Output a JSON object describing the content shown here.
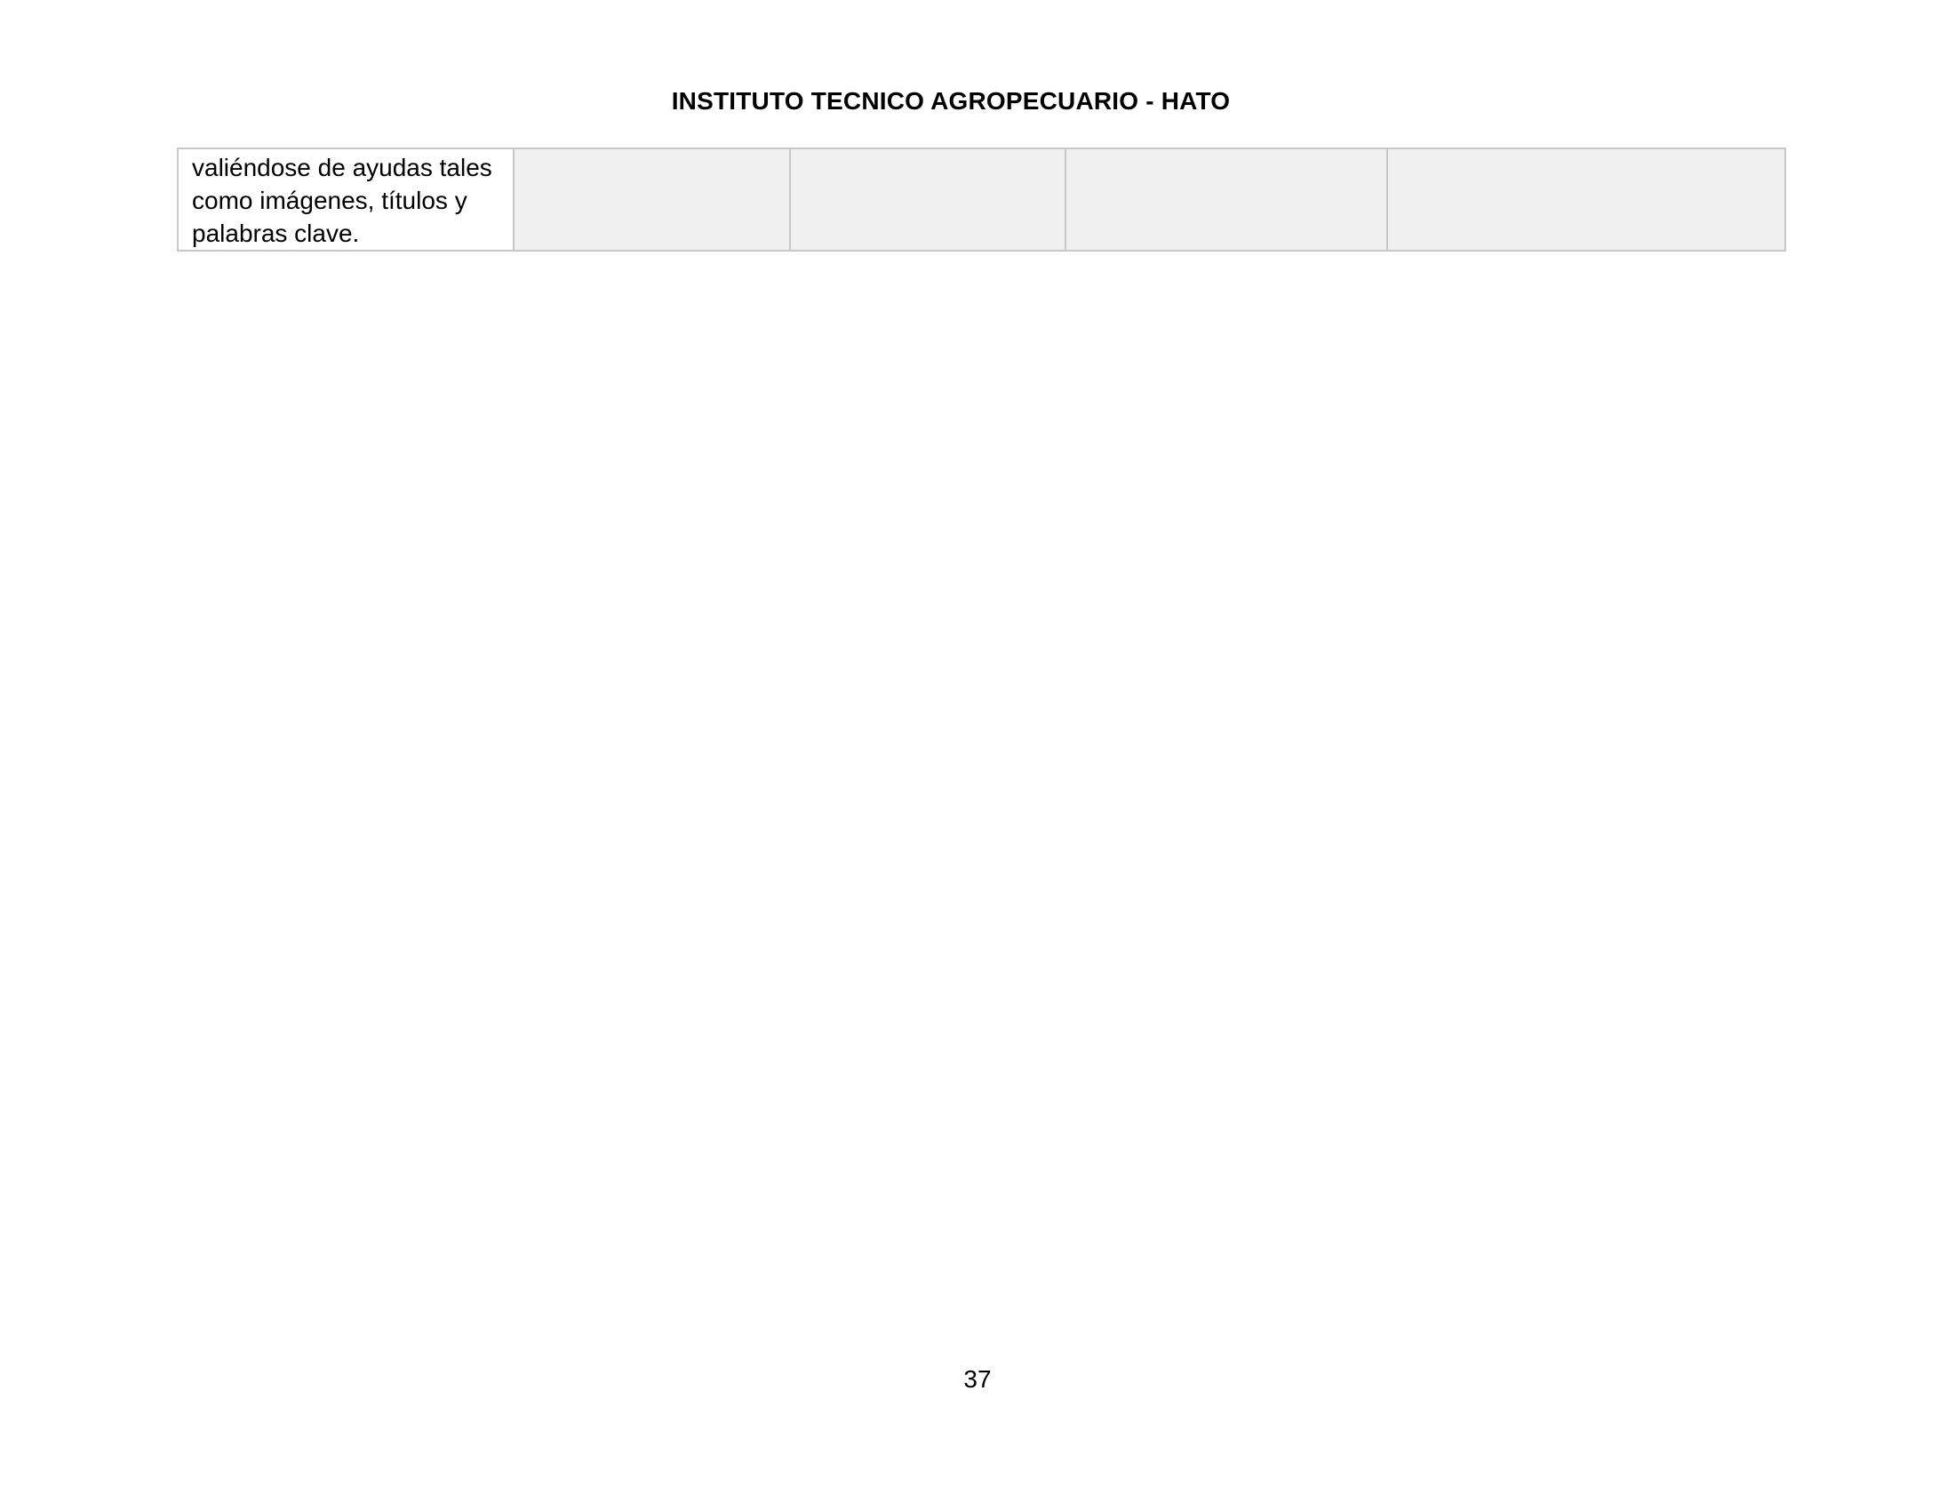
{
  "header": {
    "title": "INSTITUTO TECNICO AGROPECUARIO - HATO"
  },
  "table": {
    "rows": [
      {
        "cells": [
          "valiéndose de ayudas tales\ncomo imágenes, títulos y\npalabras clave.",
          "",
          "",
          "",
          ""
        ]
      }
    ]
  },
  "footer": {
    "page_number": "37"
  }
}
